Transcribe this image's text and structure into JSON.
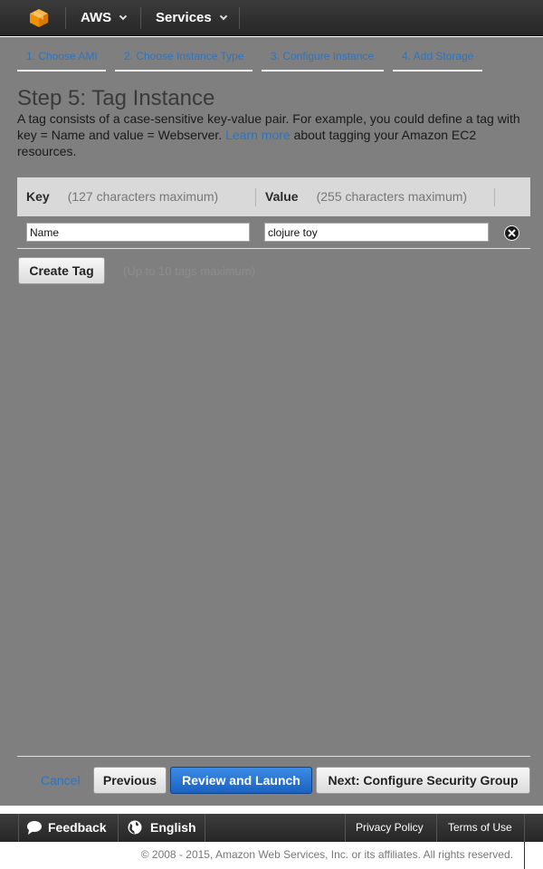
{
  "topnav": {
    "logo_icon": "aws-cube-icon",
    "account_label": "AWS",
    "services_label": "Services"
  },
  "wizard": {
    "steps": [
      "1. Choose AMI",
      "2. Choose Instance Type",
      "3. Configure Instance",
      "4. Add Storage"
    ],
    "title": "Step 5: Tag Instance",
    "description_pre": "A tag consists of a case-sensitive key-value pair. For example, you could define a tag with key = Name and value = Webserver.",
    "learn_more": "Learn more",
    "description_post": "about tagging your Amazon EC2 resources."
  },
  "tags_table": {
    "key_header": "Key",
    "key_note": "(127 characters maximum)",
    "value_header": "Value",
    "value_note": "(255 characters maximum)",
    "rows": [
      {
        "key": "Name",
        "value": "clojure toy"
      }
    ],
    "create_tag_label": "Create Tag",
    "limit_note": "(Up to 10 tags maximum)"
  },
  "actions": {
    "cancel": "Cancel",
    "previous": "Previous",
    "review_launch": "Review and Launch",
    "next": "Next: Configure Security Group"
  },
  "footer": {
    "feedback": "Feedback",
    "language": "English",
    "privacy": "Privacy Policy",
    "terms": "Terms of Use",
    "copyright": "© 2008 - 2015, Amazon Web Services, Inc. or its affiliates. All rights reserved."
  },
  "colors": {
    "accent_blue": "#2e74c0",
    "overlay_gray": "#7f7f7f",
    "logo_orange": "#f29100"
  }
}
